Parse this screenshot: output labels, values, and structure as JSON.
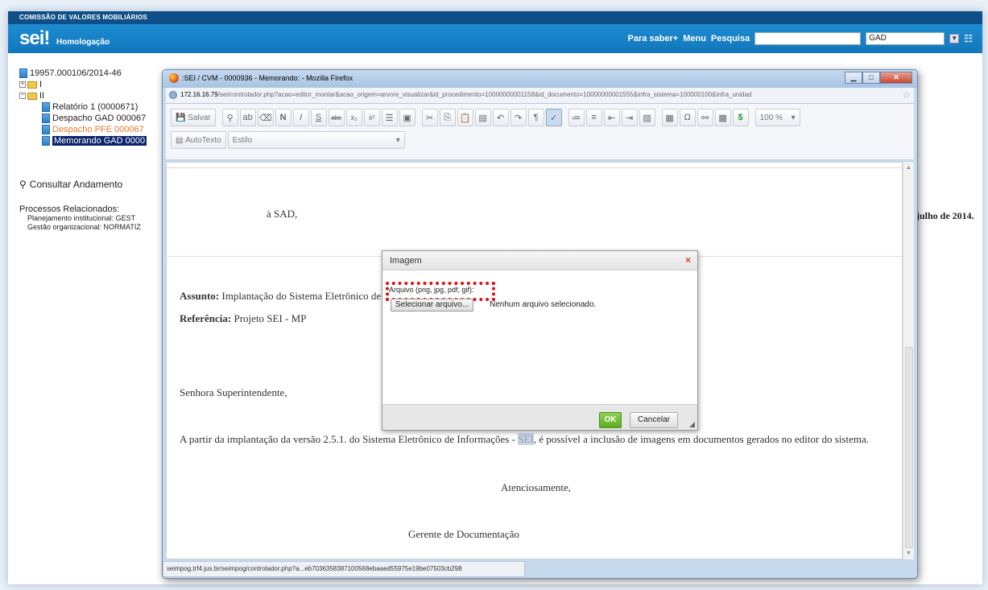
{
  "app": {
    "org_name": "COMISSÃO DE VALORES MOBILIÁRIOS",
    "logo": "sei!",
    "environment": "Homologação",
    "nav": {
      "para_saber": "Para saber+",
      "menu": "Menu",
      "pesquisa": "Pesquisa"
    },
    "search_value": "",
    "unit_value": "GAD"
  },
  "tree": {
    "process": "19957.000106/2014-46",
    "folder1": "I",
    "folder2": "II",
    "docs": [
      "Relatório 1 (0000671)",
      "Despacho GAD 000067",
      "Despacho PFE 000067",
      "Memorando GAD 0000"
    ]
  },
  "sidebar": {
    "consultar": "Consultar Andamento",
    "rel_title": "Processos Relacionados:",
    "rel_items": [
      "Planejamento institucional: GEST",
      "Gestão organizacional: NORMATIZ"
    ]
  },
  "background_doc": {
    "date_fragment": "julho de 2014."
  },
  "firefox": {
    "title": ":SEI / CVM - 0000936 - Memorando: - Mozilla Firefox",
    "url_host": "172.16.16.79",
    "url_path": "/sei/controlador.php?acao=editor_montar&acao_origem=arvore_visualizar&id_procedimento=10000000001158&id_documento=10000000001555&infra_sistema=100000100&infra_unidad",
    "status": "seimpog.trf4.jus.br/seimpog/controlador.php?a...eb7036358387100568ebaaed55975e19be07503cb298"
  },
  "toolbar": {
    "salvar": "Salvar",
    "autotexto": "AutoTexto",
    "estilo": "Estilo",
    "zoom": "100 %"
  },
  "document": {
    "to": "à SAD,",
    "assunto_label": "Assunto:",
    "assunto_text": "Implantação do Sistema Eletrônico de",
    "referencia_label": "Referência:",
    "referencia_text": "Projeto SEI - MP",
    "greeting": "Senhora Superintendente,",
    "body_pre": "A partir da implantação da versão 2.5.1. do Sistema Eletrônico de Informações - ",
    "body_highlight": "SEI",
    "body_post": ", é possível a inclusão de imagens em documentos gerados no editor do sistema.",
    "closing": "Atenciosamente,",
    "signature": "Gerente de Documentação"
  },
  "dialog": {
    "title": "Imagem",
    "close": "×",
    "label": "Arquivo (png, jpg, pdf, gif):",
    "file_button": "Selecionar arquivo...",
    "file_status": "Nenhum arquivo selecionado.",
    "ok": "OK",
    "cancel": "Cancelar"
  }
}
